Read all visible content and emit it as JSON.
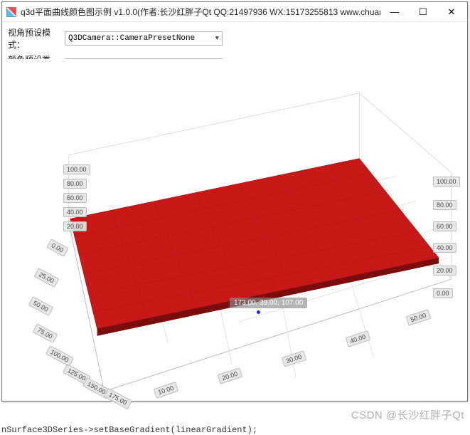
{
  "window": {
    "title": "q3d平面曲线颜色图示例 v1.0.0(作者:长沙红胖子Qt QQ:21497936 WX:15173255813 www.chuangwezhike.com"
  },
  "controls": {
    "cameraPreset": {
      "label": "视角预设模式：",
      "value": "Q3DCamera::CameraPresetNone"
    },
    "colorPreset": {
      "label": "颜色预设类型：",
      "value": ""
    }
  },
  "chart_data": {
    "type": "surface3d",
    "selected_point_label": "173.00, 39.00, 107.00",
    "x_axis": {
      "ticks": [
        "0.00",
        "25.00",
        "50.00",
        "75.00",
        "100.00",
        "125.00",
        "150.00",
        "175.00"
      ]
    },
    "y_axis": {
      "ticks": [
        "10.00",
        "20.00",
        "30.00",
        "40.00",
        "50.00"
      ]
    },
    "z_axis_left": {
      "ticks": [
        "20.00",
        "40.00",
        "60.00",
        "80.00",
        "100.00"
      ]
    },
    "z_axis_right": {
      "ticks": [
        "0.00",
        "20.00",
        "40.00",
        "60.00",
        "80.00",
        "100.00"
      ]
    },
    "surface_color": "#c81818"
  },
  "watermark": "CSDN @长沙红胖子Qt",
  "code_fragment": "nSurface3DSeries->setBaseGradient(linearGradient);"
}
